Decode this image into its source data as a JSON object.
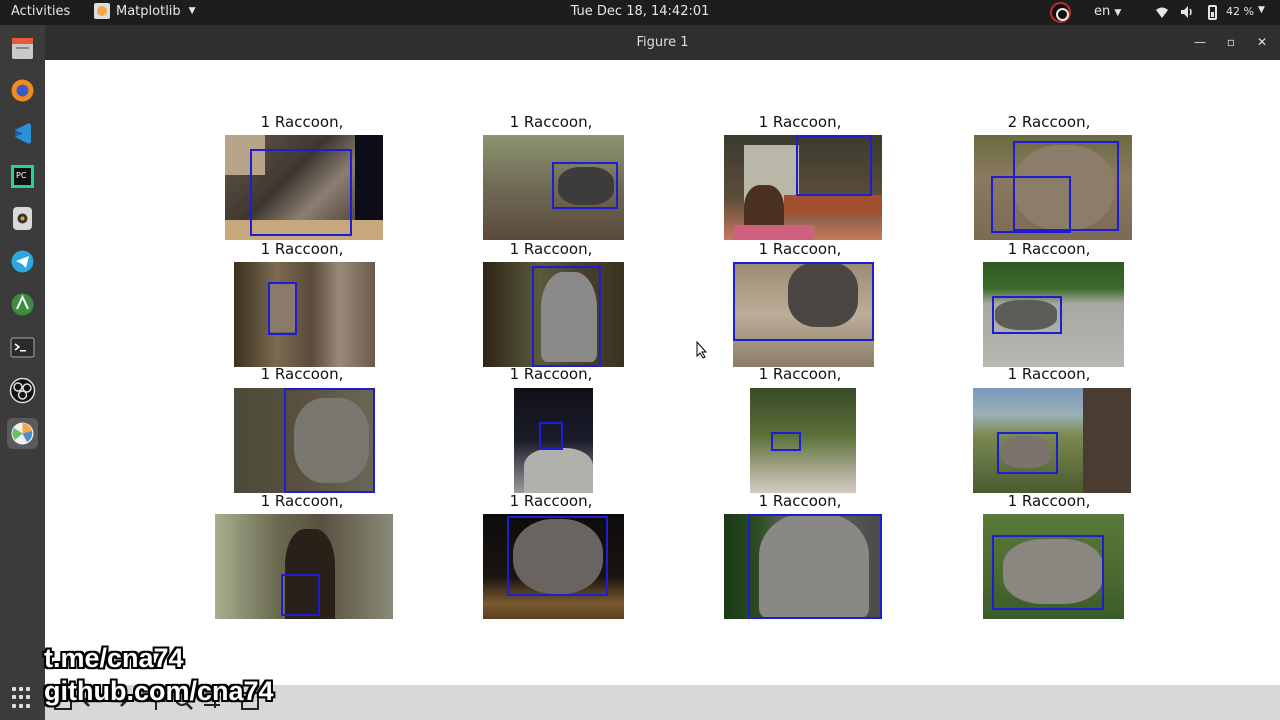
{
  "topbar": {
    "activities": "Activities",
    "app_name": "Matplotlib",
    "clock": "Tue Dec 18, 14:42:01",
    "language": "en",
    "battery": "42 %",
    "icons": [
      "obs-tray-icon",
      "wifi-icon",
      "volume-icon",
      "battery-icon"
    ]
  },
  "dock": {
    "items": [
      "files-icon",
      "firefox-icon",
      "vscode-icon",
      "pycharm-icon",
      "disk-icon",
      "telegram-icon",
      "android-studio-icon",
      "terminal-icon",
      "obs-icon",
      "matplotlib-icon"
    ],
    "apps_grid": "show-apps-icon"
  },
  "window": {
    "title": "Figure 1",
    "controls": [
      "minimize-icon",
      "maximize-icon",
      "close-icon"
    ]
  },
  "figure": {
    "titles": [
      "1 Raccoon,",
      "1 Raccoon,",
      "1 Raccoon,",
      "2 Raccoon,",
      "1 Raccoon,",
      "1 Raccoon,",
      "1 Raccoon,",
      "1 Raccoon,",
      "1 Raccoon,",
      "1 Raccoon,",
      "1 Raccoon,",
      "1 Raccoon,",
      "1 Raccoon,",
      "1 Raccoon,",
      "1 Raccoon,",
      "1 Raccoon,"
    ],
    "detection_color": "#1d1dd6"
  },
  "toolbar": {
    "buttons": [
      "home-icon",
      "back-icon",
      "forward-icon",
      "pan-icon",
      "zoom-icon",
      "subplots-icon",
      "save-icon"
    ]
  },
  "watermark": {
    "line1": "t.me/cna74",
    "line2": "github.com/cna74"
  }
}
